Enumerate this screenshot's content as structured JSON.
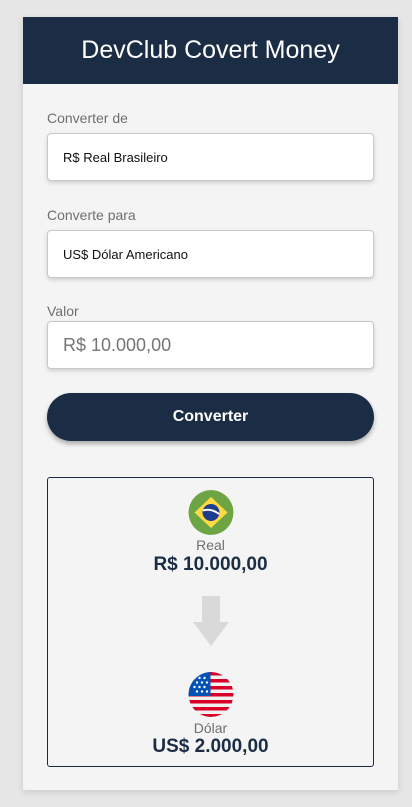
{
  "header": {
    "title": "DevClub Covert Money"
  },
  "form": {
    "from_label": "Converter de",
    "from_value": "R$ Real Brasileiro",
    "to_label": "Converte para",
    "to_value": "US$ Dólar Americano",
    "amount_label": "Valor",
    "amount_placeholder": "R$ 10.000,00",
    "convert_button": "Converter"
  },
  "result": {
    "from_currency_name": "Real",
    "from_amount": "R$ 10.000,00",
    "to_currency_name": "Dólar",
    "to_amount": "US$ 2.000,00"
  },
  "colors": {
    "primary": "#1b2d45",
    "background": "#f4f4f4",
    "page": "#e6e6e6"
  },
  "icons": [
    "brazil-flag-icon",
    "arrow-down-icon",
    "usa-flag-icon"
  ]
}
